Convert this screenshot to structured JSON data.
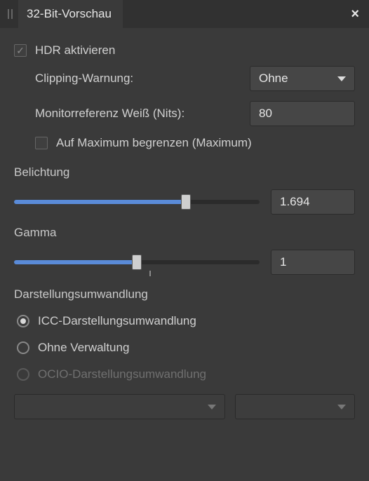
{
  "header": {
    "title": "32-Bit-Vorschau"
  },
  "hdr": {
    "activate_label": "HDR aktivieren",
    "activate_checked": true,
    "clipping_label": "Clipping-Warnung:",
    "clipping_value": "Ohne",
    "monitor_label": "Monitorreferenz Weiß (Nits):",
    "monitor_value": "80",
    "limit_label": "Auf Maximum begrenzen (Maximum)",
    "limit_checked": false
  },
  "exposure": {
    "title": "Belichtung",
    "value": "1.694",
    "fill_percent": 70
  },
  "gamma": {
    "title": "Gamma",
    "value": "1",
    "fill_percent": 50,
    "tick_percent": 55
  },
  "render": {
    "title": "Darstellungsumwandlung",
    "options": {
      "icc": "ICC-Darstellungsumwandlung",
      "none": "Ohne Verwaltung",
      "ocio": "OCIO-Darstellungsumwandlung"
    },
    "selected": "icc",
    "ocio_select1": "",
    "ocio_select2": ""
  }
}
